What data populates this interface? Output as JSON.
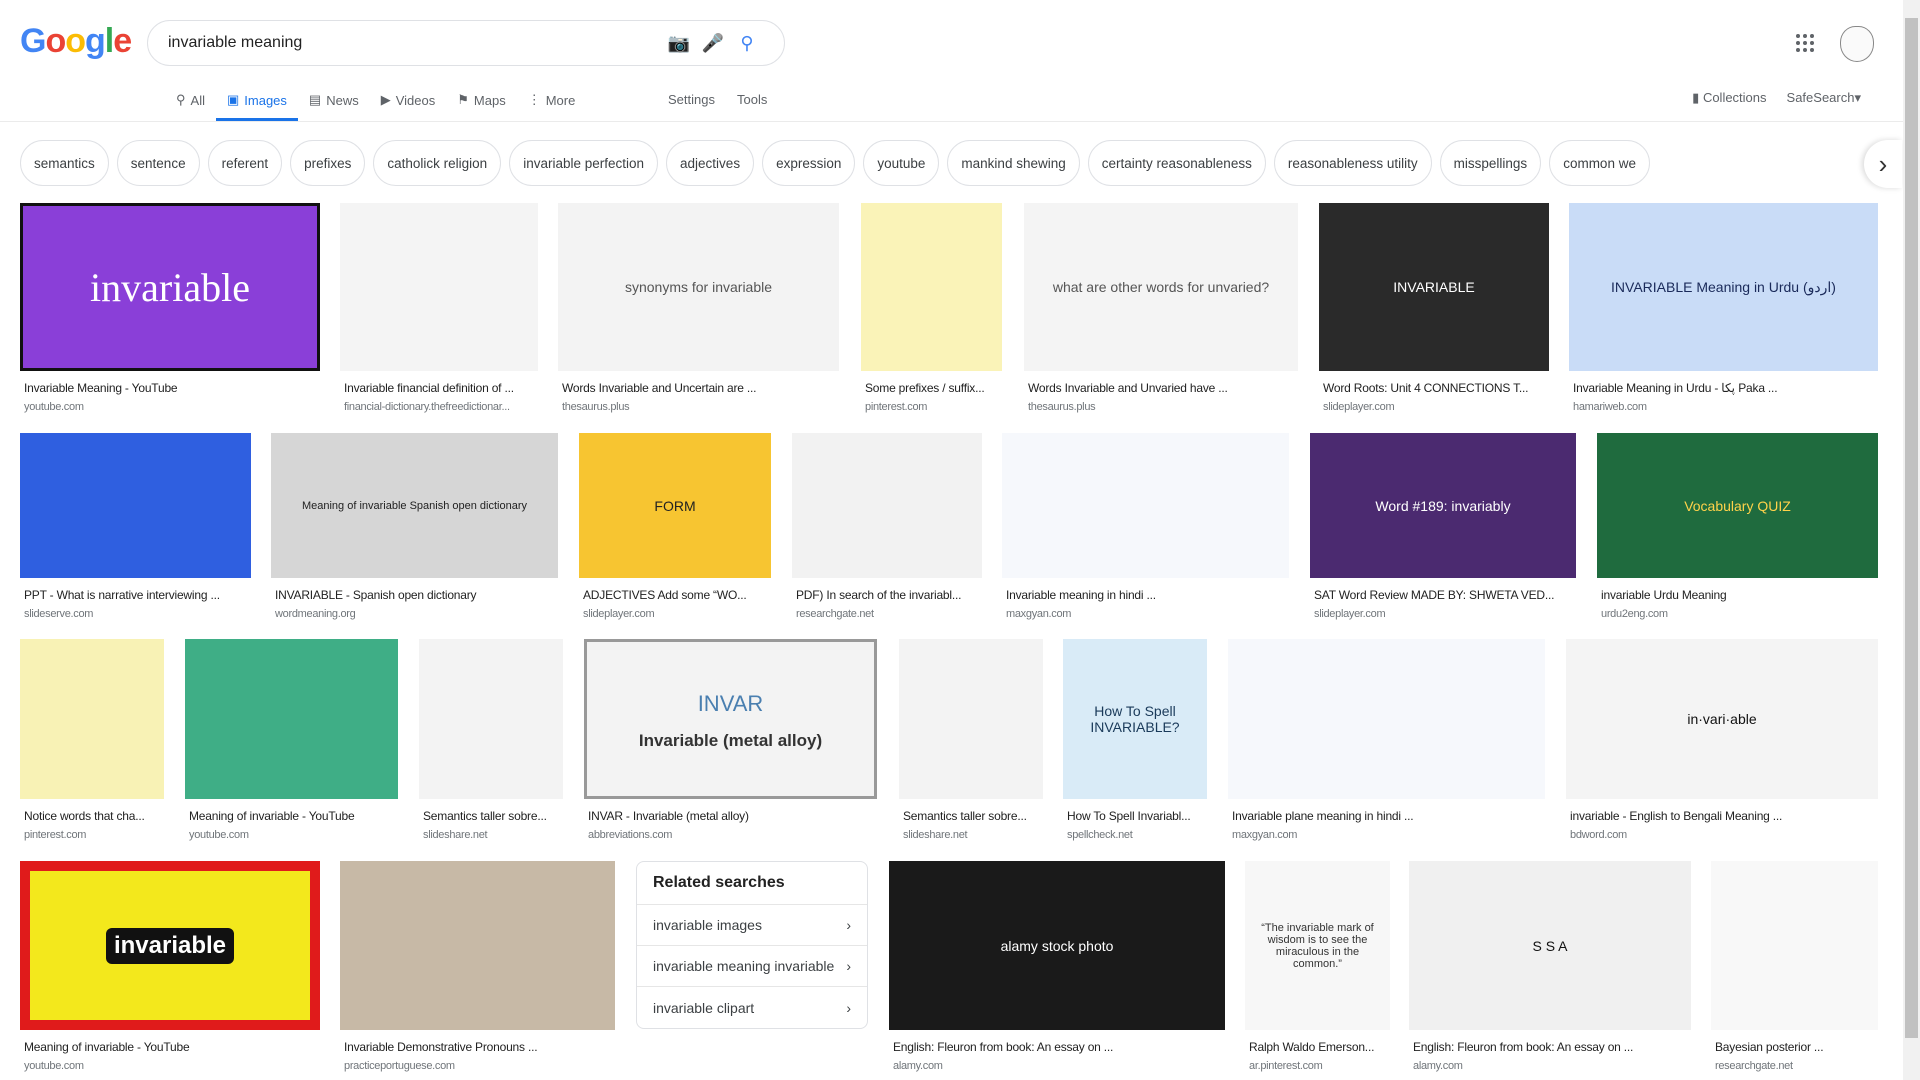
{
  "header": {
    "logo": "Google",
    "query": "invariable meaning"
  },
  "tabs": [
    {
      "label": "All",
      "icon": "search-icon"
    },
    {
      "label": "Images",
      "icon": "image-icon",
      "active": true
    },
    {
      "label": "News",
      "icon": "news-icon"
    },
    {
      "label": "Videos",
      "icon": "video-icon"
    },
    {
      "label": "Maps",
      "icon": "map-icon"
    },
    {
      "label": "More",
      "icon": "more-vert-icon"
    }
  ],
  "tools": [
    "Settings",
    "Tools"
  ],
  "right": {
    "collections": "Collections",
    "safesearch": "SafeSearch"
  },
  "chips": [
    "semantics",
    "sentence",
    "referent",
    "prefixes",
    "catholick religion",
    "invariable perfection",
    "adjectives",
    "expression",
    "youtube",
    "mankind shewing",
    "certainty reasonableness",
    "reasonableness utility",
    "misspellings",
    "common we"
  ],
  "rows": [
    [
      {
        "title": "Invariable Meaning - YouTube",
        "source": "youtube.com",
        "bg": "#8a3fd8",
        "text": "invariable",
        "fg": "#fff",
        "border": "#111"
      },
      {
        "title": "Invariable financial definition of ...",
        "source": "financial-dictionary.thefreedictionar...",
        "bg": "#f4f4f4",
        "text": "",
        "fg": "#333"
      },
      {
        "title": "Words Invariable and Uncertain are ...",
        "source": "thesaurus.plus",
        "bg": "#f3f3f3",
        "text": "synonyms for invariable",
        "fg": "#555"
      },
      {
        "title": "Some prefixes / suffix...",
        "source": "pinterest.com",
        "bg": "#faf3b8",
        "text": "",
        "fg": "#333"
      },
      {
        "title": "Words Invariable and Unvaried have ...",
        "source": "thesaurus.plus",
        "bg": "#f4f4f4",
        "text": "what are other words for unvaried?",
        "fg": "#555"
      },
      {
        "title": "Word Roots: Unit 4 CONNECTIONS T...",
        "source": "slideplayer.com",
        "bg": "#2a2a2a",
        "text": "INVARIABLE",
        "fg": "#fff"
      },
      {
        "title": "Invariable Meaning in Urdu - پکا Paka ...",
        "source": "hamariweb.com",
        "bg": "#c9dcf7",
        "text": "INVARIABLE Meaning in Urdu (اردو)",
        "fg": "#1a2a5a"
      }
    ],
    [
      {
        "title": "PPT - What is narrative interviewing ...",
        "source": "slideserve.com",
        "bg": "#2f5fe0",
        "text": "",
        "fg": "#fff"
      },
      {
        "title": "INVARIABLE - Spanish open dictionary",
        "source": "wordmeaning.org",
        "bg": "#d6d6d6",
        "text": "Meaning of invariable Spanish open dictionary",
        "fg": "#222"
      },
      {
        "title": "ADJECTIVES Add some “WO...",
        "source": "slideplayer.com",
        "bg": "#f7c531",
        "text": "FORM",
        "fg": "#222"
      },
      {
        "title": "PDF) In search of the invariabl...",
        "source": "researchgate.net",
        "bg": "#f2f2f2",
        "text": "",
        "fg": "#333"
      },
      {
        "title": "Invariable meaning in hindi ...",
        "source": "maxgyan.com",
        "bg": "#f6f8fc",
        "text": "",
        "fg": "#333"
      },
      {
        "title": "SAT Word Review MADE BY: SHWETA VED...",
        "source": "slideplayer.com",
        "bg": "#4b2a70",
        "text": "Word #189: invariably",
        "fg": "#fff"
      },
      {
        "title": "invariable Urdu Meaning",
        "source": "urdu2eng.com",
        "bg": "#1f6b3e",
        "text": "Vocabulary QUIZ",
        "fg": "#ffd24a"
      }
    ],
    [
      {
        "title": "Notice words that cha...",
        "source": "pinterest.com",
        "bg": "#f8f2b5",
        "text": "",
        "fg": "#333"
      },
      {
        "title": "Meaning of invariable - YouTube",
        "source": "youtube.com",
        "bg": "#3fae86",
        "text": "",
        "fg": "#fff"
      },
      {
        "title": "Semantics taller sobre...",
        "source": "slideshare.net",
        "bg": "#f3f3f3",
        "text": "",
        "fg": "#333"
      },
      {
        "title": "INVAR - Invariable (metal alloy)",
        "source": "abbreviations.com",
        "bg": "#f3f3f3",
        "text": "INVAR",
        "sub": "Invariable (metal alloy)",
        "fg": "#4a7fb0",
        "border": "#999"
      },
      {
        "title": "Semantics taller sobre...",
        "source": "slideshare.net",
        "bg": "#f3f3f3",
        "text": "",
        "fg": "#333"
      },
      {
        "title": "How To Spell Invariabl...",
        "source": "spellcheck.net",
        "bg": "#d9ebf7",
        "text": "How To Spell INVARIABLE?",
        "fg": "#1a3a5a"
      },
      {
        "title": "Invariable plane meaning in hindi ...",
        "source": "maxgyan.com",
        "bg": "#f6f8fc",
        "text": "",
        "fg": "#333"
      },
      {
        "title": "invariable - English to Bengali Meaning ...",
        "source": "bdword.com",
        "bg": "#f4f4f4",
        "text": "in·vari·able",
        "fg": "#111"
      }
    ],
    [
      {
        "title": "Meaning of invariable - YouTube",
        "source": "youtube.com",
        "bg": "#f3e81c",
        "text": "invariable",
        "fg": "#fff",
        "border": "#e01b1b"
      },
      {
        "title": "Invariable Demonstrative Pronouns ...",
        "source": "practiceportuguese.com",
        "bg": "#c7b9a6",
        "text": "",
        "fg": "#333"
      },
      null,
      {
        "title": "English: Fleuron from book: An essay on ...",
        "source": "alamy.com",
        "bg": "#1a1a1a",
        "text": "alamy stock photo",
        "fg": "#fff"
      },
      {
        "title": "Ralph Waldo Emerson...",
        "source": "ar.pinterest.com",
        "bg": "#f7f7f7",
        "text": "“The invariable mark of wisdom is to see the miraculous in the common.”",
        "fg": "#333"
      },
      {
        "title": "English: Fleuron from book: An essay on ...",
        "source": "alamy.com",
        "bg": "#f0f0f0",
        "text": "S S A",
        "fg": "#111"
      },
      {
        "title": "Bayesian posterior ...",
        "source": "researchgate.net",
        "bg": "#f8f8f8",
        "text": "",
        "fg": "#333"
      }
    ]
  ],
  "related": {
    "title": "Related searches",
    "items": [
      "invariable images",
      "invariable meaning invariable",
      "invariable clipart"
    ]
  }
}
